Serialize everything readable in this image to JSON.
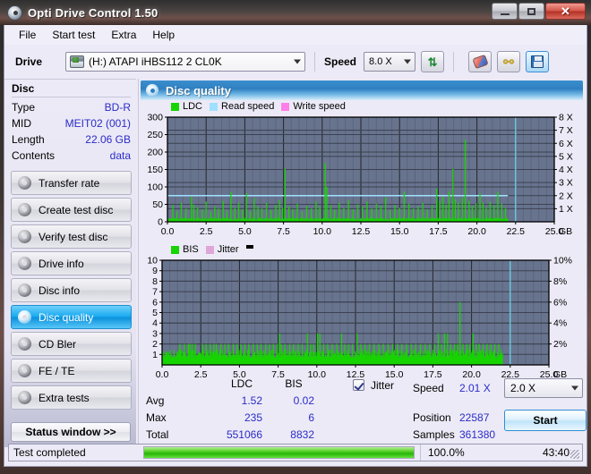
{
  "window": {
    "title": "Opti Drive Control 1.50",
    "icon": "disc-icon",
    "buttons": {
      "minimize": "minimize",
      "maximize": "maximize",
      "close": "close"
    }
  },
  "menu": {
    "items": [
      "File",
      "Start test",
      "Extra",
      "Help"
    ]
  },
  "toolbar": {
    "drive_label": "Drive",
    "drive_value": "(H:)  ATAPI iHBS112  2 CL0K",
    "speed_label": "Speed",
    "speed_value": "8.0 X",
    "buttons": [
      "refresh-icon",
      "eraser-icon",
      "bolt-icon",
      "save-icon"
    ]
  },
  "sidebar": {
    "disc": {
      "title": "Disc",
      "rows": [
        {
          "key": "Type",
          "value": "BD-R"
        },
        {
          "key": "MID",
          "value": "MEIT02 (001)"
        },
        {
          "key": "Length",
          "value": "22.06 GB"
        },
        {
          "key": "Contents",
          "value": "data"
        }
      ]
    },
    "items": [
      {
        "label": "Transfer rate",
        "active": false
      },
      {
        "label": "Create test disc",
        "active": false
      },
      {
        "label": "Verify test disc",
        "active": false
      },
      {
        "label": "Drive info",
        "active": false
      },
      {
        "label": "Disc info",
        "active": false
      },
      {
        "label": "Disc quality",
        "active": true
      },
      {
        "label": "CD Bler",
        "active": false
      },
      {
        "label": "FE / TE",
        "active": false
      },
      {
        "label": "Extra tests",
        "active": false
      }
    ],
    "status_button": "Status window >>"
  },
  "panel": {
    "title": "Disc quality",
    "icon": "disc-quality-icon"
  },
  "stats": {
    "col_headers": [
      "LDC",
      "BIS"
    ],
    "rows": [
      {
        "label": "Avg",
        "ldc": "1.52",
        "bis": "0.02"
      },
      {
        "label": "Max",
        "ldc": "235",
        "bis": "6"
      },
      {
        "label": "Total",
        "ldc": "551066",
        "bis": "8832"
      }
    ],
    "jitter_label": "Jitter",
    "jitter_checked": true,
    "speed_label": "Speed",
    "speed_value": "2.01 X",
    "position_label": "Position",
    "position_value": "22587",
    "samples_label": "Samples",
    "samples_value": "361380",
    "speed_select": "2.0 X",
    "start_button": "Start"
  },
  "statusbar": {
    "text": "Test completed",
    "percent": "100.0%",
    "progress": 100,
    "time": "43:40"
  },
  "colors": {
    "ldc_green": "#17d400",
    "read_speed": "#9fe0ff",
    "write_speed": "#ff7fe8",
    "bis_green": "#17d400",
    "jitter_pink": "#e0a6d8",
    "plot_bg": "#68748e",
    "accent_blue": "#1d8fd0",
    "value_blue": "#2b2bc8"
  },
  "chart_data": [
    {
      "type": "line",
      "title": "LDC / Read speed",
      "legend": [
        {
          "name": "LDC",
          "color": "#17d400"
        },
        {
          "name": "Read speed",
          "color": "#9fe0ff"
        },
        {
          "name": "Write speed",
          "color": "#ff7fe8"
        }
      ],
      "legend_position": "top-left",
      "grid": true,
      "xlabel": "GB",
      "xlim": [
        0,
        25
      ],
      "xticks": [
        "0.0",
        "2.5",
        "5.0",
        "7.5",
        "10.0",
        "12.5",
        "15.0",
        "17.5",
        "20.0",
        "22.5",
        "25.0"
      ],
      "ylabel_left": "LDC",
      "ylim_left": [
        0,
        300
      ],
      "yticks_left": [
        "0",
        "50",
        "100",
        "150",
        "200",
        "250",
        "300"
      ],
      "ylabel_right": "Speed",
      "ylim_right": [
        0,
        8
      ],
      "yticks_right": [
        "1 X",
        "2 X",
        "3 X",
        "4 X",
        "5 X",
        "6 X",
        "7 X",
        "8 X"
      ],
      "scan_end_gb": 22.0,
      "cursor_gb": 22.5,
      "series": [
        {
          "name": "Read speed",
          "color": "#9fe0ff",
          "axis": "right",
          "note": "flat at 2.0 X across scanned region",
          "x": [
            0.0,
            22.0
          ],
          "values": [
            2.0,
            2.0
          ]
        },
        {
          "name": "LDC",
          "color": "#17d400",
          "axis": "left",
          "note": "dense noisy baseline ~5-20 with sparse spikes",
          "baseline": 8,
          "spikes": [
            [
              0.35,
              48
            ],
            [
              0.6,
              30
            ],
            [
              0.9,
              55
            ],
            [
              1.2,
              38
            ],
            [
              1.55,
              72
            ],
            [
              1.7,
              50
            ],
            [
              1.95,
              42
            ],
            [
              2.25,
              35
            ],
            [
              2.5,
              58
            ],
            [
              2.8,
              30
            ],
            [
              3.05,
              45
            ],
            [
              3.3,
              38
            ],
            [
              3.6,
              60
            ],
            [
              3.85,
              32
            ],
            [
              4.1,
              85
            ],
            [
              4.35,
              40
            ],
            [
              4.6,
              55
            ],
            [
              4.85,
              36
            ],
            [
              5.1,
              82
            ],
            [
              5.35,
              30
            ],
            [
              5.6,
              68
            ],
            [
              5.85,
              44
            ],
            [
              6.1,
              38
            ],
            [
              6.4,
              55
            ],
            [
              6.7,
              34
            ],
            [
              7.0,
              48
            ],
            [
              7.25,
              62
            ],
            [
              7.45,
              40
            ],
            [
              7.6,
              152
            ],
            [
              7.85,
              44
            ],
            [
              8.1,
              36
            ],
            [
              8.4,
              52
            ],
            [
              8.7,
              30
            ],
            [
              9.0,
              46
            ],
            [
              9.3,
              38
            ],
            [
              9.6,
              58
            ],
            [
              9.85,
              42
            ],
            [
              10.2,
              168
            ],
            [
              10.3,
              100
            ],
            [
              10.55,
              48
            ],
            [
              10.8,
              35
            ],
            [
              11.1,
              55
            ],
            [
              11.4,
              40
            ],
            [
              11.7,
              62
            ],
            [
              12.0,
              36
            ],
            [
              12.3,
              50
            ],
            [
              12.6,
              44
            ],
            [
              12.9,
              58
            ],
            [
              13.2,
              38
            ],
            [
              13.5,
              52
            ],
            [
              13.8,
              45
            ],
            [
              14.1,
              70
            ],
            [
              14.4,
              34
            ],
            [
              14.7,
              48
            ],
            [
              15.0,
              40
            ],
            [
              15.3,
              86
            ],
            [
              15.6,
              52
            ],
            [
              15.9,
              38
            ],
            [
              16.2,
              44
            ],
            [
              16.5,
              55
            ],
            [
              16.8,
              35
            ],
            [
              17.1,
              48
            ],
            [
              17.4,
              95
            ],
            [
              17.6,
              60
            ],
            [
              17.8,
              72
            ],
            [
              18.0,
              50
            ],
            [
              18.2,
              88
            ],
            [
              18.45,
              152
            ],
            [
              18.6,
              65
            ],
            [
              18.8,
              55
            ],
            [
              19.05,
              70
            ],
            [
              19.25,
              235
            ],
            [
              19.5,
              60
            ],
            [
              19.7,
              45
            ],
            [
              19.95,
              52
            ],
            [
              20.2,
              80
            ],
            [
              20.4,
              55
            ],
            [
              20.6,
              42
            ],
            [
              20.85,
              58
            ],
            [
              21.1,
              48
            ],
            [
              21.35,
              86
            ],
            [
              21.6,
              52
            ],
            [
              21.85,
              40
            ]
          ]
        }
      ]
    },
    {
      "type": "line",
      "title": "BIS / Jitter",
      "legend": [
        {
          "name": "BIS",
          "color": "#17d400"
        },
        {
          "name": "Jitter",
          "color": "#e0a6d8"
        }
      ],
      "legend_position": "top-left",
      "grid": true,
      "xlabel": "GB",
      "xlim": [
        0,
        25
      ],
      "xticks": [
        "0.0",
        "2.5",
        "5.0",
        "7.5",
        "10.0",
        "12.5",
        "15.0",
        "17.5",
        "20.0",
        "22.5",
        "25.0"
      ],
      "ylabel_left": "BIS",
      "ylim_left": [
        0,
        10
      ],
      "yticks_left": [
        "1",
        "2",
        "3",
        "4",
        "5",
        "6",
        "7",
        "8",
        "9",
        "10"
      ],
      "ylabel_right": "Jitter",
      "ylim_right": [
        0,
        10
      ],
      "yticks_right": [
        "2%",
        "4%",
        "6%",
        "8%",
        "10%"
      ],
      "scan_end_gb": 22.0,
      "cursor_gb": 22.5,
      "series": [
        {
          "name": "BIS",
          "color": "#17d400",
          "axis": "left",
          "note": "solid band at 1 with frequent spikes to 2, occasional 3 and one 6",
          "baseline": 1,
          "spikes": [
            [
              1.15,
              2
            ],
            [
              1.45,
              2
            ],
            [
              1.7,
              2
            ],
            [
              1.8,
              2
            ],
            [
              1.95,
              2
            ],
            [
              2.15,
              2
            ],
            [
              2.6,
              2
            ],
            [
              2.85,
              2
            ],
            [
              3.1,
              2
            ],
            [
              3.35,
              2
            ],
            [
              3.5,
              2
            ],
            [
              3.8,
              2
            ],
            [
              4.05,
              2
            ],
            [
              4.3,
              2
            ],
            [
              4.6,
              2
            ],
            [
              4.85,
              2
            ],
            [
              5.1,
              2
            ],
            [
              5.35,
              2
            ],
            [
              5.6,
              2
            ],
            [
              5.9,
              2
            ],
            [
              6.15,
              2
            ],
            [
              6.4,
              2
            ],
            [
              6.7,
              2
            ],
            [
              6.95,
              2
            ],
            [
              7.2,
              2
            ],
            [
              7.45,
              2
            ],
            [
              7.6,
              3
            ],
            [
              7.7,
              2
            ],
            [
              7.95,
              2
            ],
            [
              8.25,
              2
            ],
            [
              8.5,
              2
            ],
            [
              8.8,
              2
            ],
            [
              9.05,
              2
            ],
            [
              9.4,
              3
            ],
            [
              9.6,
              2
            ],
            [
              9.8,
              2
            ],
            [
              10.05,
              3
            ],
            [
              10.2,
              3
            ],
            [
              10.45,
              2
            ],
            [
              10.7,
              2
            ],
            [
              11.0,
              2
            ],
            [
              11.3,
              2
            ],
            [
              11.6,
              3
            ],
            [
              11.8,
              2
            ],
            [
              12.05,
              2
            ],
            [
              12.3,
              2
            ],
            [
              12.6,
              3
            ],
            [
              12.85,
              2
            ],
            [
              13.1,
              2
            ],
            [
              13.4,
              2
            ],
            [
              13.7,
              2
            ],
            [
              14.0,
              2
            ],
            [
              14.3,
              2
            ],
            [
              14.6,
              2
            ],
            [
              14.9,
              2
            ],
            [
              15.2,
              2
            ],
            [
              15.5,
              2
            ],
            [
              15.8,
              2
            ],
            [
              16.1,
              2
            ],
            [
              16.4,
              2
            ],
            [
              16.7,
              2
            ],
            [
              17.0,
              2
            ],
            [
              17.3,
              2
            ],
            [
              17.6,
              2
            ],
            [
              17.85,
              3
            ],
            [
              18.05,
              2
            ],
            [
              18.25,
              3
            ],
            [
              18.45,
              3
            ],
            [
              18.65,
              2
            ],
            [
              18.9,
              2
            ],
            [
              19.1,
              2
            ],
            [
              19.25,
              6
            ],
            [
              19.45,
              2
            ],
            [
              19.7,
              2
            ],
            [
              19.9,
              2
            ],
            [
              20.1,
              3
            ],
            [
              20.3,
              2
            ],
            [
              20.5,
              2
            ],
            [
              20.75,
              2
            ],
            [
              21.0,
              2
            ],
            [
              21.25,
              2
            ],
            [
              21.5,
              2
            ],
            [
              21.75,
              2
            ]
          ]
        }
      ]
    }
  ]
}
